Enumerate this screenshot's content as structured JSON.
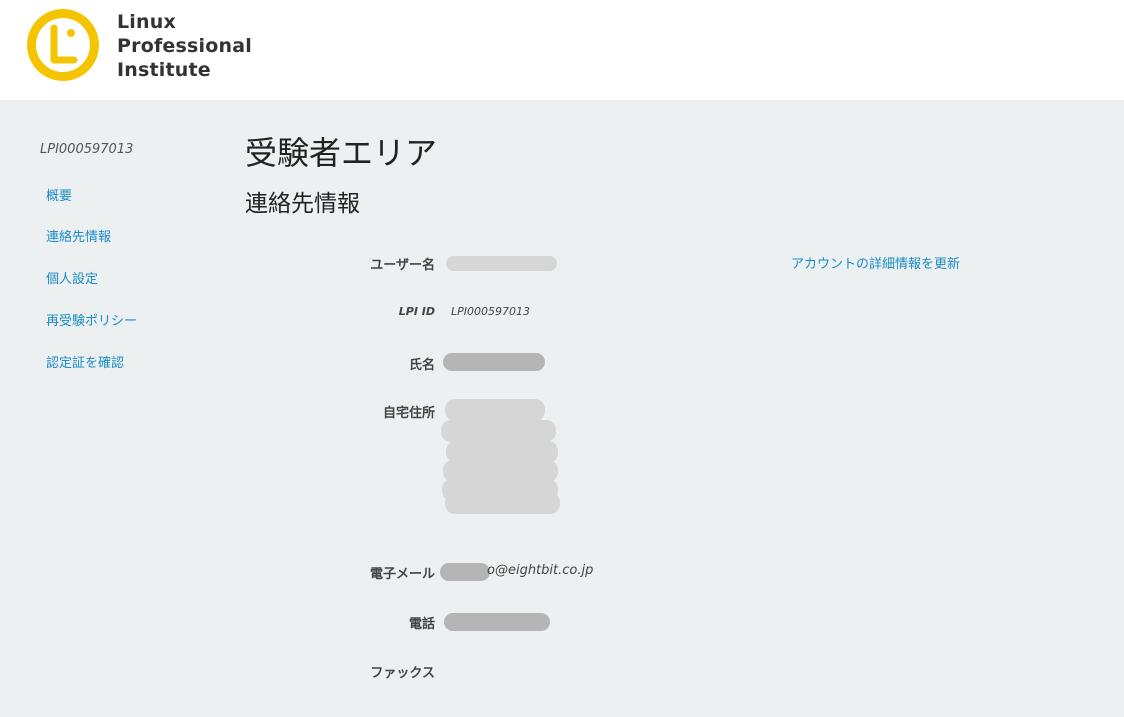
{
  "logo": {
    "line1": "Linux",
    "line2": "Professional",
    "line3": "Institute",
    "colors": {
      "circle": "#f5c400",
      "text": "#333333"
    }
  },
  "sidebar": {
    "user_id": "LPI000597013",
    "items": [
      {
        "label": "概要"
      },
      {
        "label": "連絡先情報"
      },
      {
        "label": "個人設定"
      },
      {
        "label": "再受験ポリシー"
      },
      {
        "label": "認定証を確認"
      }
    ]
  },
  "main": {
    "page_title": "受験者エリア",
    "section_title": "連絡先情報",
    "update_link": "アカウントの詳細情報を更新",
    "fields": {
      "username_label": "ユーザー名",
      "lpiid_label": "LPI ID",
      "lpiid_value": "LPI000597013",
      "name_label": "氏名",
      "address_label": "自宅住所",
      "email_label": "電子メール",
      "email_visible_part": "o@eightbit.co.jp",
      "phone_label": "電話",
      "fax_label": "ファックス"
    }
  },
  "colors": {
    "link": "#1a8cc7",
    "background": "#ecf0f1",
    "header": "#ffffff"
  }
}
